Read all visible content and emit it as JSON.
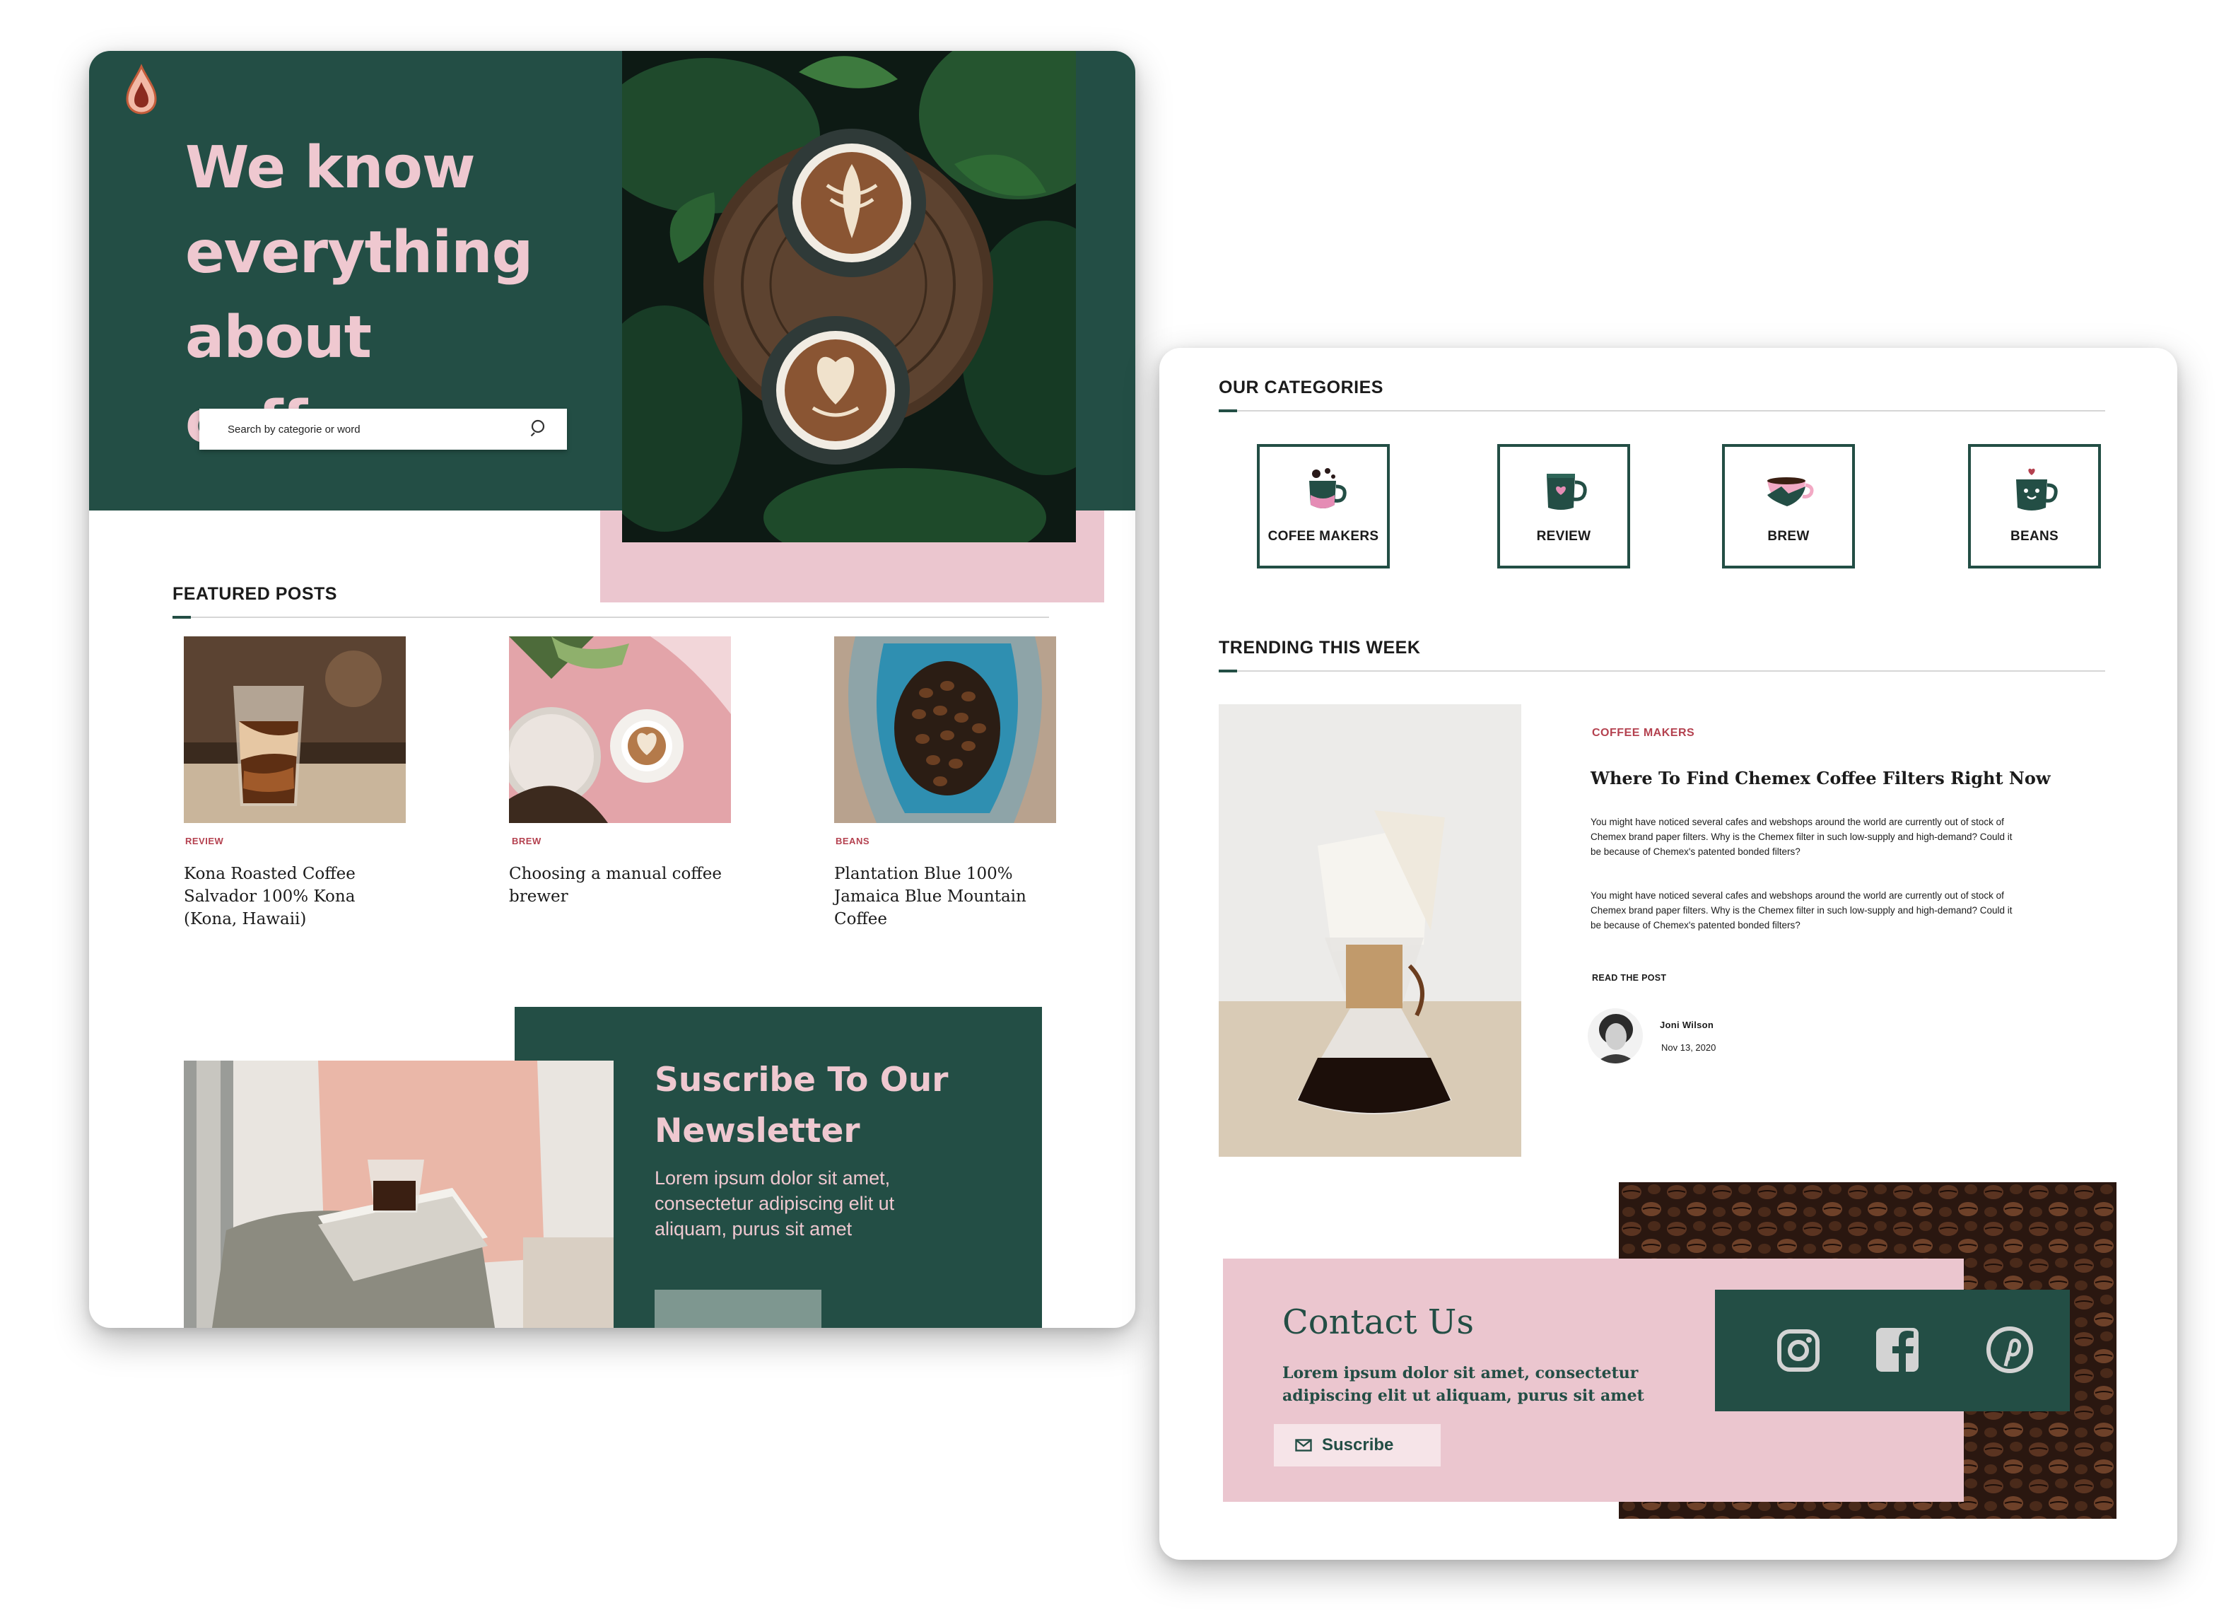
{
  "hero": {
    "title_line1": "We know",
    "title_line2": "everything about",
    "title_line3": "coffee",
    "search_placeholder": "Search by categorie or word"
  },
  "featured": {
    "title": "FEATURED POSTS",
    "posts": [
      {
        "tag": "REVIEW",
        "title": "Kona Roasted Coffee Salvador 100% Kona (Kona, Hawaii)"
      },
      {
        "tag": "BREW",
        "title": "Choosing a manual coffee brewer"
      },
      {
        "tag": "BEANS",
        "title": "Plantation Blue 100% Jamaica Blue Mountain Coffee"
      }
    ]
  },
  "newsletter": {
    "title_line1": "Suscribe To Our",
    "title_line2": "Newsletter",
    "text": "Lorem ipsum dolor sit amet, consectetur adipiscing elit ut aliquam, purus sit amet"
  },
  "categories": {
    "title": "OUR CATEGORIES",
    "items": [
      {
        "label": "COFEE MAKERS",
        "icon": "mug-splash-icon"
      },
      {
        "label": "REVIEW",
        "icon": "mug-heart-icon"
      },
      {
        "label": "BREW",
        "icon": "cup-pink-icon"
      },
      {
        "label": "BEANS",
        "icon": "mug-face-icon"
      }
    ]
  },
  "trending": {
    "title": "TRENDING THIS WEEK",
    "tag": "COFFEE MAKERS",
    "post_title": "Where To Find Chemex Coffee Filters Right Now",
    "paragraph1": "You might have noticed several cafes and webshops around the world are currently out of stock of Chemex brand paper filters. Why is the Chemex filter in such low-supply and high-demand? Could it be because of Chemex's patented bonded filters?",
    "paragraph2": "You might have noticed several cafes and webshops around the world are currently out of stock of Chemex brand paper filters. Why is the Chemex filter in such low-supply and high-demand? Could it be because of Chemex's patented bonded filters?",
    "read_more": "READ THE POST",
    "author": "Joni Wilson",
    "date": "Nov 13, 2020"
  },
  "contact": {
    "title": "Contact Us",
    "text": "Lorem ipsum dolor sit amet, consectetur adipiscing elit ut aliquam, purus sit amet",
    "button": "Suscribe",
    "socials": [
      "instagram-icon",
      "facebook-icon",
      "pinterest-icon"
    ]
  },
  "colors": {
    "green": "#234e45",
    "pink": "#ebc6cf",
    "accent_red": "#b4414f"
  }
}
